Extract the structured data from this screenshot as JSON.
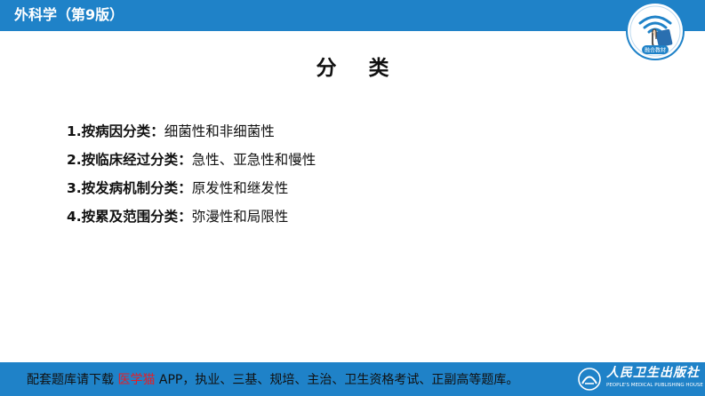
{
  "header": {
    "title": "外科学（第9版）",
    "logo_label": "融合教材"
  },
  "slide": {
    "title": "分 类",
    "items": [
      {
        "term": "1.按病因分类",
        "sep": "：",
        "desc": "细菌性和非细菌性"
      },
      {
        "term": "2.按临床经过分类",
        "sep": "：",
        "desc": "急性、亚急性和慢性"
      },
      {
        "term": "3.按发病机制分类",
        "sep": "：",
        "desc": "原发性和继发性"
      },
      {
        "term": "4.按累及范围分类",
        "sep": "：",
        "desc": "弥漫性和局限性"
      }
    ]
  },
  "footer": {
    "text_before": "配套题库请下载 ",
    "highlight": "医学猫",
    "text_after": " APP，执业、三基、规培、主治、卫生资格考试、正副高等题库。",
    "publisher_cn": "人民卫生出版社",
    "publisher_en": "PEOPLE'S MEDICAL PUBLISHING HOUSE"
  },
  "colors": {
    "bar_blue": "#1f82c8",
    "highlight_red": "#e0202a"
  },
  "icons": {
    "logo": "wifi-hand-tap-icon",
    "publisher": "publisher-logo-icon"
  }
}
